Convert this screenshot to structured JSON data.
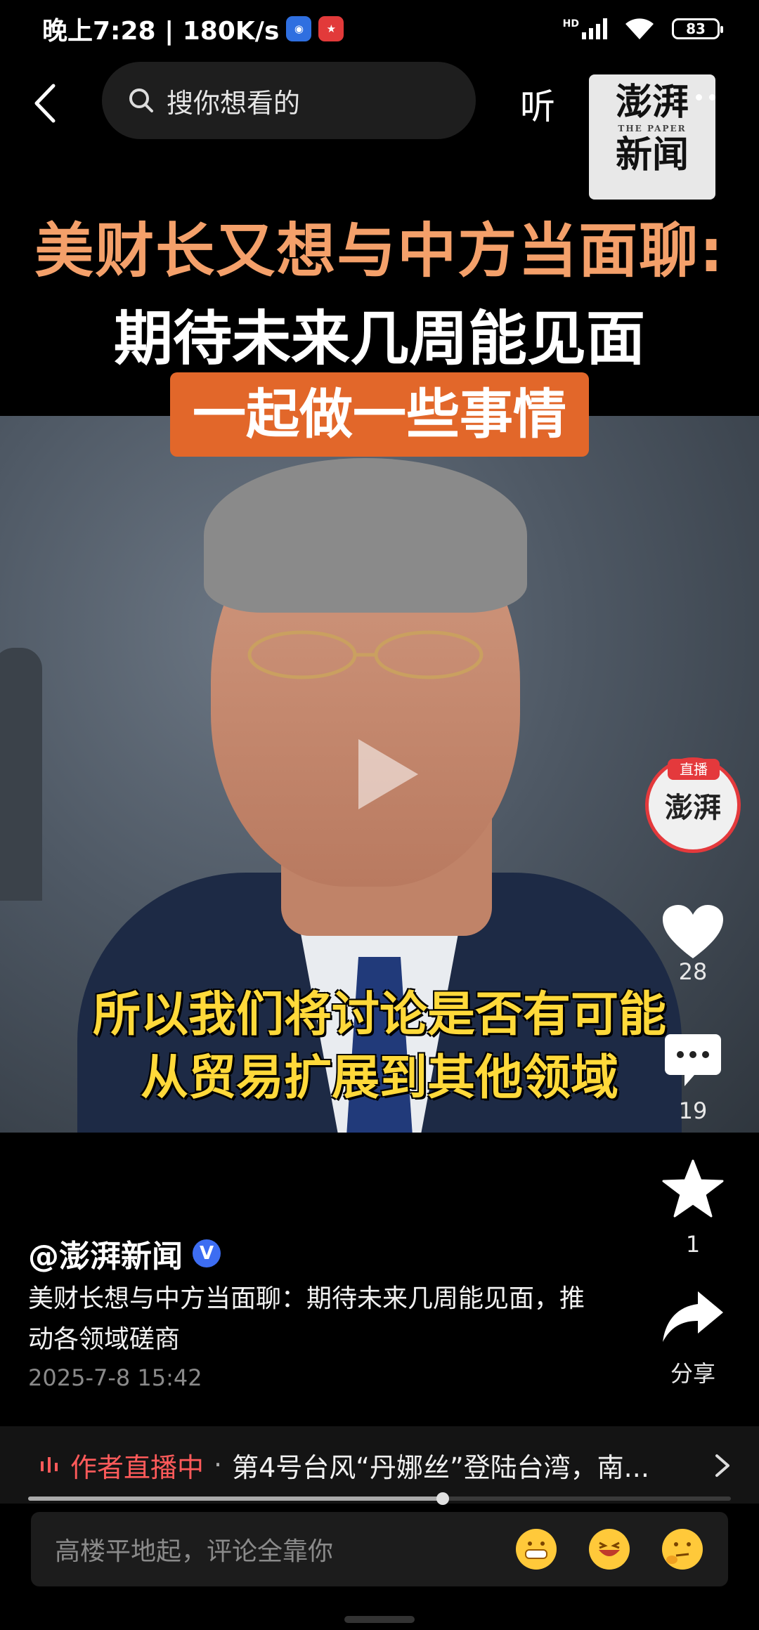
{
  "status_bar": {
    "time_speed": "晚上7:28 | 180K/s",
    "network_label": "HD",
    "battery": "83"
  },
  "top_nav": {
    "search_placeholder": "搜你想看的",
    "listen_label": "听",
    "logo_line1": "澎湃",
    "logo_sub": "THE PAPER",
    "logo_line2": "新闻"
  },
  "video": {
    "headline_line1": "美财长又想与中方当面聊:",
    "headline_line2": "期待未来几周能见面",
    "headline_line3": "一起做一些事情",
    "subtitle_line1": "所以我们将讨论是否有可能",
    "subtitle_line2": "从贸易扩展到其他领域"
  },
  "actions": {
    "live_tag": "直播",
    "live_avatar_text": "澎湃",
    "like_count": "28",
    "comment_count": "19",
    "favorite_count": "1",
    "share_label": "分享"
  },
  "post": {
    "author": "@澎湃新闻",
    "verified_mark": "V",
    "description": "美财长想与中方当面聊：期待未来几周能见面，推动各领域磋商",
    "date": "2025-7-8 15:42"
  },
  "live_bar": {
    "label": "作者直播中",
    "separator": "·",
    "text": "第4号台风“丹娜丝”登陆台湾，南..."
  },
  "progress": {
    "fraction": 0.59
  },
  "comment": {
    "placeholder": "高楼平地起，评论全靠你"
  },
  "colors": {
    "accent_orange": "#e2672a",
    "headline_orange": "#f4a06a",
    "subtitle_yellow": "#ffd93a",
    "live_red": "#ff5a5a",
    "verified_blue": "#3d6df2"
  }
}
